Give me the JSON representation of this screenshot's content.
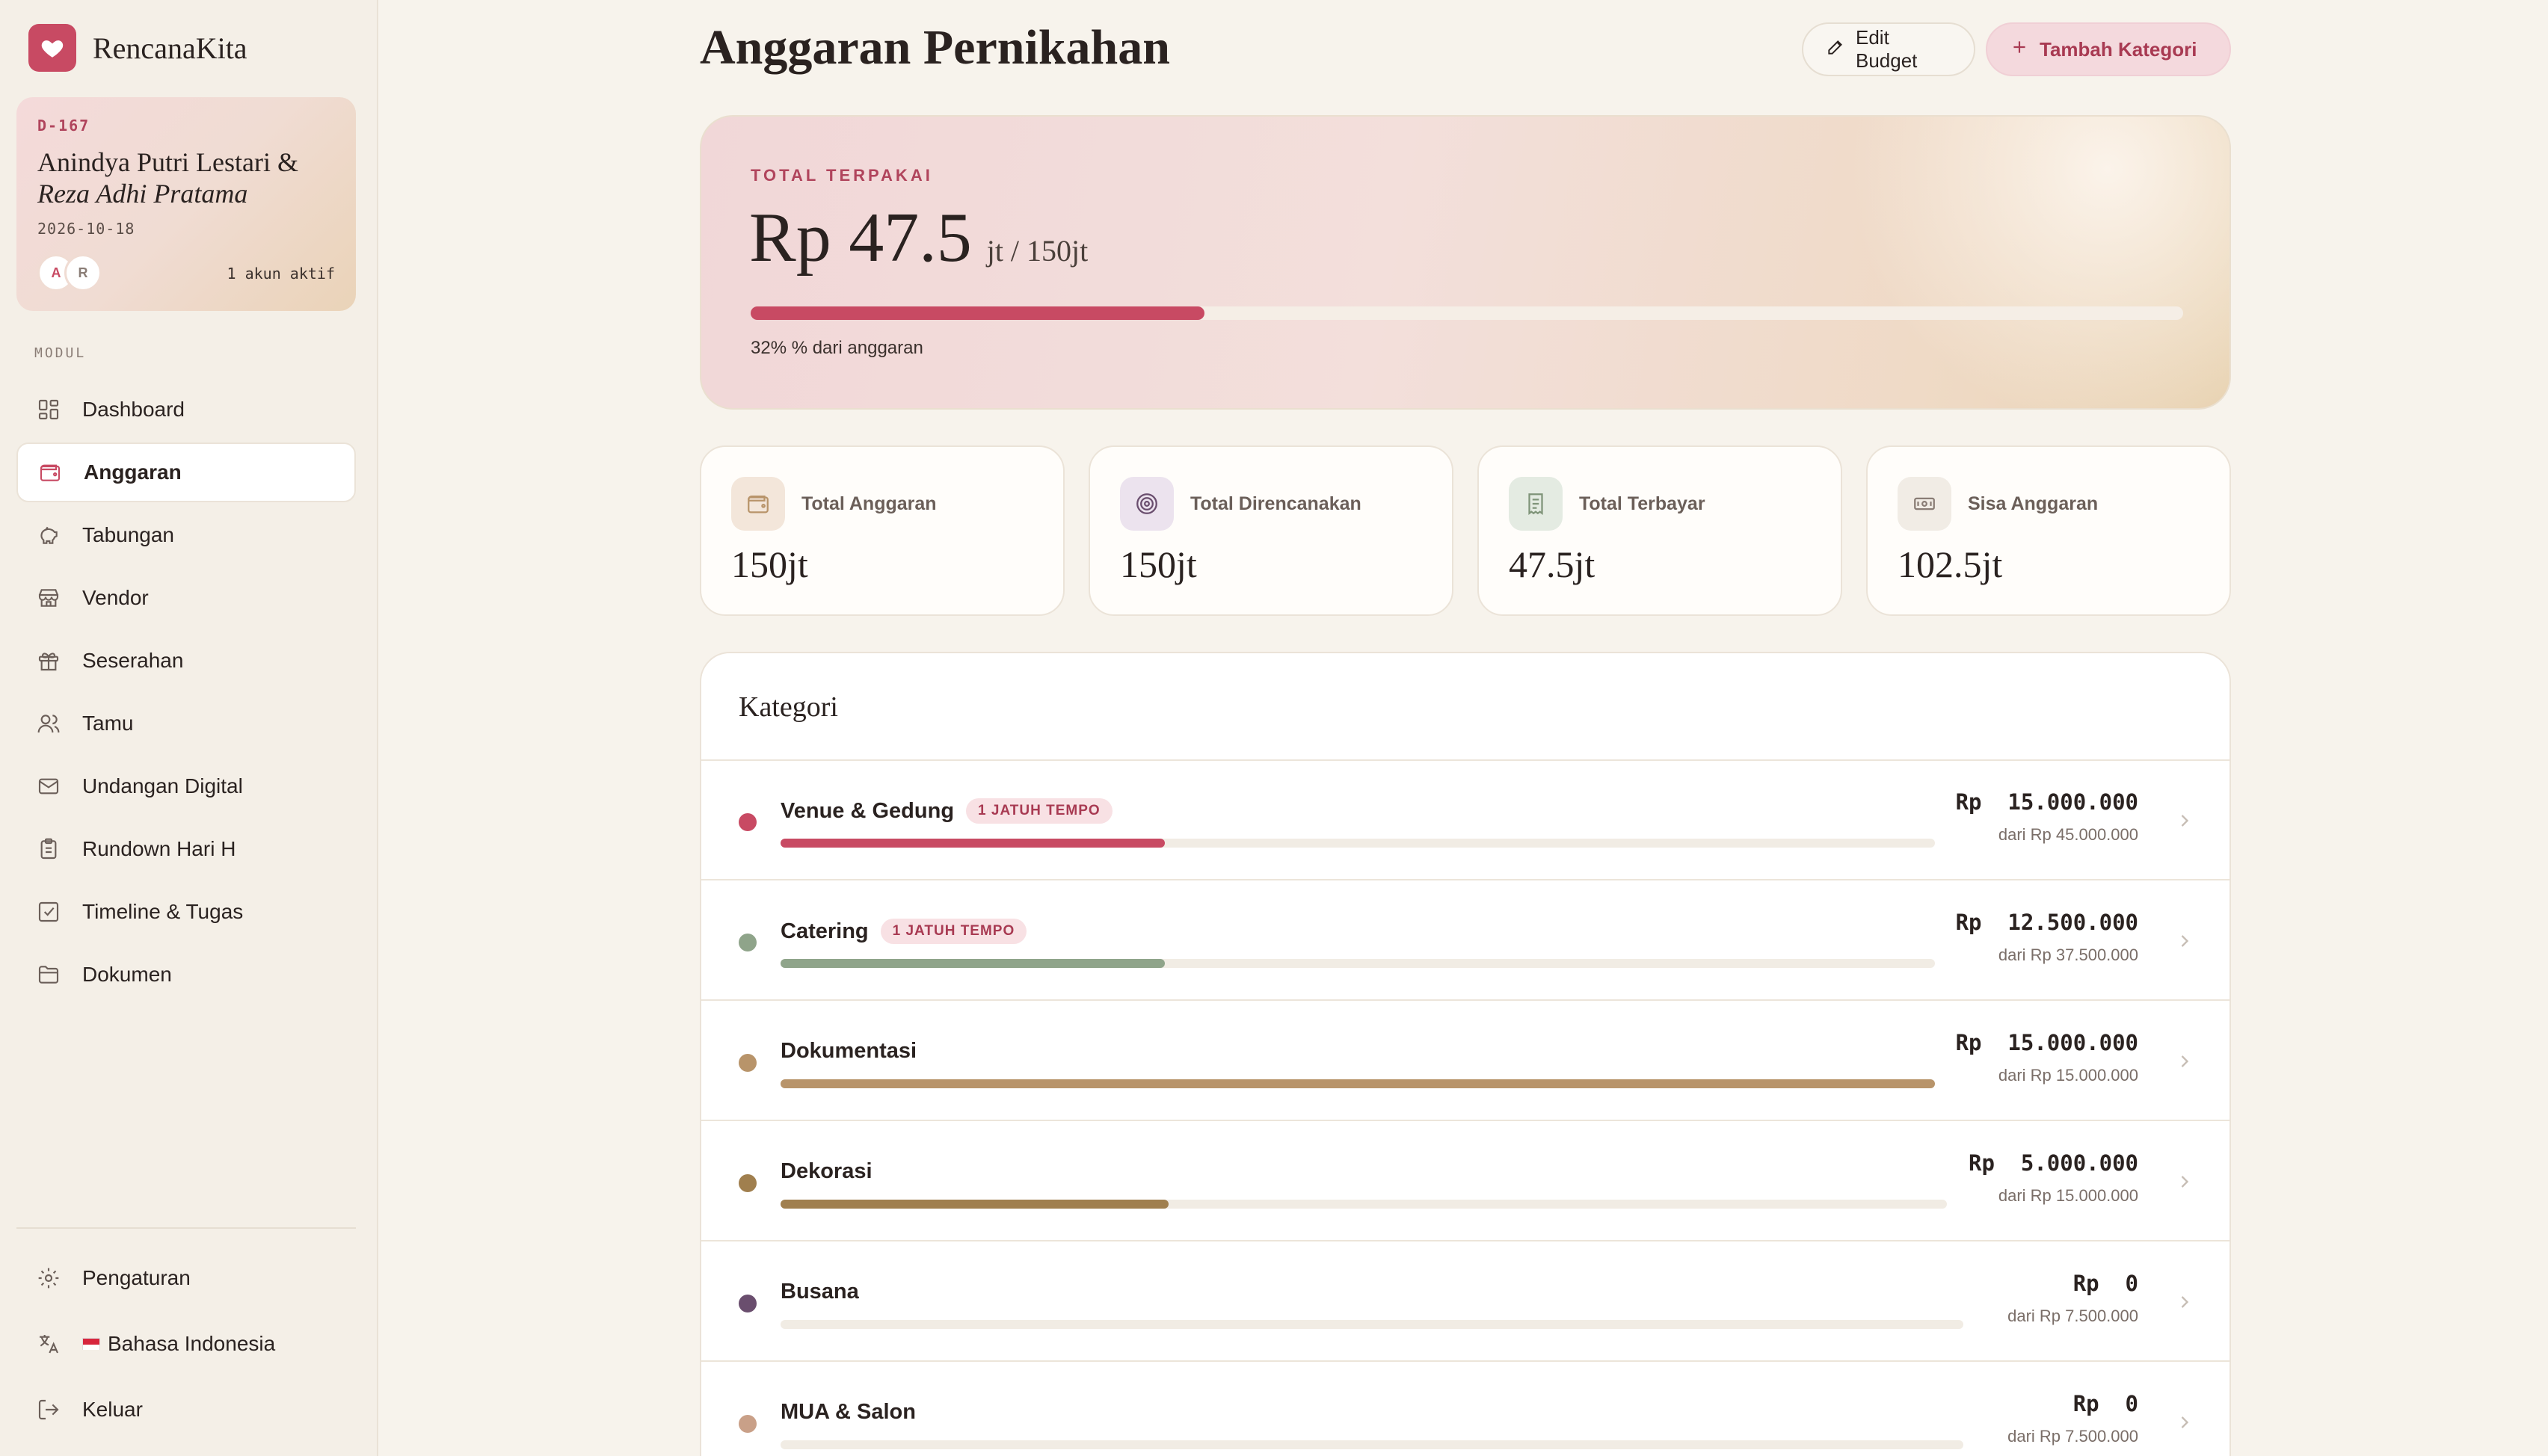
{
  "app": {
    "name": "RencanaKita",
    "logo_icon": "heart-icon",
    "accent": "#c84a63"
  },
  "couple": {
    "countdown": "D-167",
    "name_1": "Anindya Putri Lestari &",
    "name_2": "Reza Adhi Pratama",
    "date": "2026-10-18",
    "avatars": [
      "A",
      "R"
    ],
    "active_accounts": "1 akun aktif"
  },
  "sidebar": {
    "section_label": "MODUL",
    "items": [
      {
        "label": "Dashboard",
        "icon": "dashboard-icon",
        "active": false
      },
      {
        "label": "Anggaran",
        "icon": "wallet-icon",
        "active": true
      },
      {
        "label": "Tabungan",
        "icon": "piggy-bank-icon",
        "active": false
      },
      {
        "label": "Vendor",
        "icon": "store-icon",
        "active": false
      },
      {
        "label": "Seserahan",
        "icon": "gift-icon",
        "active": false
      },
      {
        "label": "Tamu",
        "icon": "users-icon",
        "active": false
      },
      {
        "label": "Undangan Digital",
        "icon": "mail-icon",
        "active": false
      },
      {
        "label": "Rundown Hari H",
        "icon": "clipboard-icon",
        "active": false
      },
      {
        "label": "Timeline & Tugas",
        "icon": "checkbox-icon",
        "active": false
      },
      {
        "label": "Dokumen",
        "icon": "folder-icon",
        "active": false
      }
    ],
    "bottom": {
      "settings": "Pengaturan",
      "language": "Bahasa Indonesia",
      "logout": "Keluar"
    }
  },
  "page": {
    "title": "Anggaran Pernikahan",
    "edit_button": "Edit Budget",
    "add_button": "Tambah Kategori"
  },
  "hero": {
    "label": "TOTAL TERPAKAI",
    "amount": "Rp 47.5",
    "of": "jt / 150jt",
    "progress": 0.317,
    "percent_text": "32% % dari anggaran"
  },
  "stats": [
    {
      "label": "Total Anggaran",
      "value": "150jt",
      "icon": "wallet-icon",
      "color": "#f3e6da"
    },
    {
      "label": "Total Direncanakan",
      "value": "150jt",
      "icon": "target-icon",
      "color": "#ece3ee"
    },
    {
      "label": "Total Terbayar",
      "value": "47.5jt",
      "icon": "receipt-icon",
      "color": "#e4ebe2"
    },
    {
      "label": "Sisa Anggaran",
      "value": "102.5jt",
      "icon": "cash-icon",
      "color": "#f1ece5"
    }
  ],
  "categories_title": "Kategori",
  "categories": [
    {
      "name": "Venue & Gedung",
      "badge": "1 JATUH TEMPO",
      "amount": "Rp  15.000.000",
      "of": "dari Rp  45.000.000",
      "progress": 0.333,
      "color": "#c84a63"
    },
    {
      "name": "Catering",
      "badge": "1 JATUH TEMPO",
      "amount": "Rp  12.500.000",
      "of": "dari Rp  37.500.000",
      "progress": 0.333,
      "color": "#8fa48a"
    },
    {
      "name": "Dokumentasi",
      "badge": "",
      "amount": "Rp  15.000.000",
      "of": "dari Rp  15.000.000",
      "progress": 1.0,
      "color": "#b8946a"
    },
    {
      "name": "Dekorasi",
      "badge": "",
      "amount": "Rp  5.000.000",
      "of": "dari Rp  15.000.000",
      "progress": 0.333,
      "color": "#a07f4e"
    },
    {
      "name": "Busana",
      "badge": "",
      "amount": "Rp  0",
      "of": "dari Rp  7.500.000",
      "progress": 0,
      "color": "#6a4e6e"
    },
    {
      "name": "MUA & Salon",
      "badge": "",
      "amount": "Rp  0",
      "of": "dari Rp  7.500.000",
      "progress": 0,
      "color": "#c9a088"
    }
  ]
}
